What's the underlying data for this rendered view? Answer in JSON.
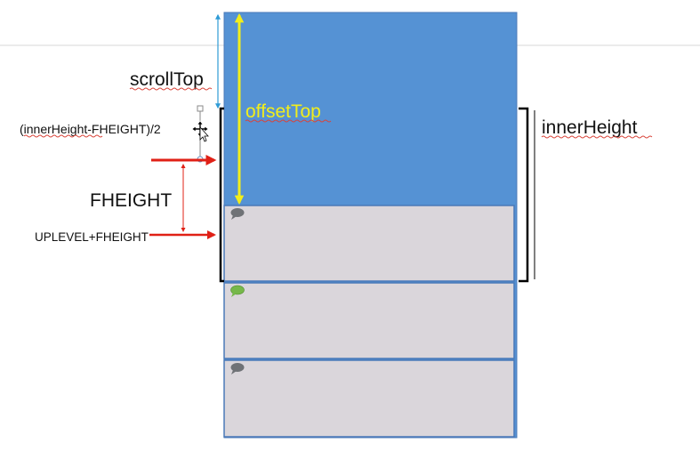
{
  "labels": {
    "scroll_top": "scrollTop",
    "offset_top": "offsetTop",
    "inner_height": "innerHeight",
    "half_formula": "(innerHeight-FHEIGHT)/2",
    "fheight": "FHEIGHT",
    "uplevel_fheight": "UPLEVEL+FHEIGHT"
  },
  "colors": {
    "viewport_blue": "#5592d4",
    "row_fill": "#dad6db",
    "row_border": "#4a79b8",
    "bubble_gray": "#6f7276",
    "bubble_green": "#76b84a",
    "offset_arrow": "#f2ee1b",
    "scroll_arrow": "#2e9bd6",
    "red_arrow": "#e02016",
    "bracket": "#000000"
  },
  "rows": [
    {
      "bubble_color": "#6f7276"
    },
    {
      "bubble_color": "#76b84a"
    },
    {
      "bubble_color": "#6f7276"
    }
  ],
  "icons": {
    "cursor": "move-cursor-icon",
    "bubble": "speech-bubble-icon"
  }
}
